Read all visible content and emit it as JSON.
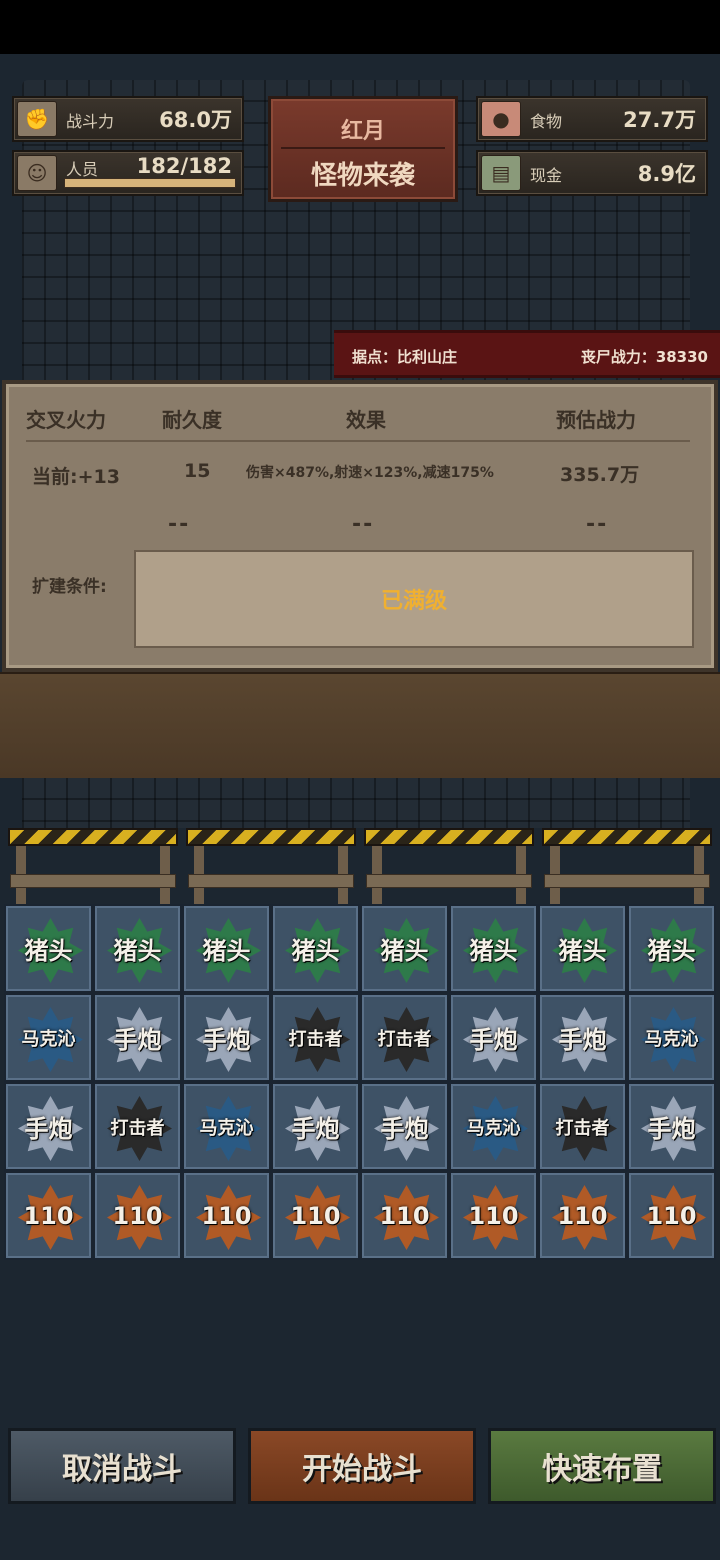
{
  "stats": {
    "combat": {
      "label": "战斗力",
      "value": "68.0万"
    },
    "personnel": {
      "label": "人员",
      "value": "182/182"
    },
    "food": {
      "label": "食物",
      "value": "27.7万"
    },
    "cash": {
      "label": "现金",
      "value": "8.9亿"
    }
  },
  "event": {
    "title": "红月",
    "subtitle": "怪物来袭"
  },
  "banner": {
    "location": "据点：比利山庄",
    "zombie_power": "丧尸战力：38330"
  },
  "panel": {
    "headers": [
      "交叉火力",
      "耐久度",
      "效果",
      "预估战力"
    ],
    "current": {
      "level": "当前:+13",
      "durability": "15",
      "effect": "伤害×487%,射速×123%,减速175%",
      "power": "335.7万"
    },
    "next": {
      "durability": "--",
      "effect": "--",
      "power": "--"
    },
    "condition_label": "扩建条件:",
    "condition_value": "已满级"
  },
  "grid": [
    [
      "猪头",
      "猪头",
      "猪头",
      "猪头",
      "猪头",
      "猪头",
      "猪头",
      "猪头"
    ],
    [
      "马克沁",
      "手炮",
      "手炮",
      "打击者",
      "打击者",
      "手炮",
      "手炮",
      "马克沁"
    ],
    [
      "手炮",
      "打击者",
      "马克沁",
      "手炮",
      "手炮",
      "马克沁",
      "打击者",
      "手炮"
    ],
    [
      "110",
      "110",
      "110",
      "110",
      "110",
      "110",
      "110",
      "110"
    ]
  ],
  "buttons": {
    "cancel": "取消战斗",
    "start": "开始战斗",
    "quick": "快速布置"
  },
  "colors": {
    "green": "#2e7a4a",
    "blue": "#2a5a84",
    "silver": "#9aa6b8",
    "black": "#2a2a2a",
    "orange": "#b05a26",
    "accent_yellow": "#f0b030"
  },
  "icons": {
    "combat": "fist-icon",
    "personnel": "person-icon",
    "food": "meat-icon",
    "cash": "cash-icon"
  }
}
